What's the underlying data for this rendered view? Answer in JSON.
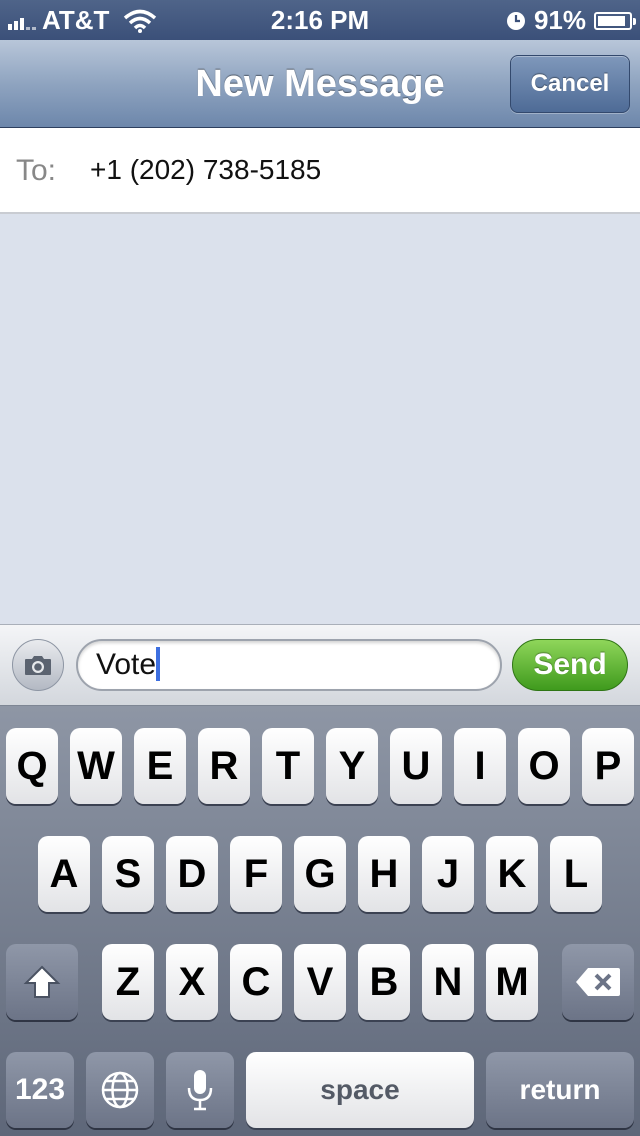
{
  "status_bar": {
    "carrier": "AT&T",
    "time": "2:16 PM",
    "battery_percent": "91%",
    "battery_level": 0.91,
    "icons": [
      "signal-icon",
      "wifi-icon",
      "clock-icon",
      "battery-icon"
    ]
  },
  "nav": {
    "title": "New Message",
    "cancel_label": "Cancel"
  },
  "to_field": {
    "label": "To:",
    "value": "+1 (202) 738-5185"
  },
  "compose": {
    "text": "Vote",
    "send_label": "Send",
    "camera_icon": "camera-icon"
  },
  "keyboard": {
    "row1": [
      "Q",
      "W",
      "E",
      "R",
      "T",
      "Y",
      "U",
      "I",
      "O",
      "P"
    ],
    "row2": [
      "A",
      "S",
      "D",
      "F",
      "G",
      "H",
      "J",
      "K",
      "L"
    ],
    "row3": [
      "Z",
      "X",
      "C",
      "V",
      "B",
      "N",
      "M"
    ],
    "numbers_label": "123",
    "space_label": "space",
    "return_label": "return",
    "shift_icon": "shift-icon",
    "delete_icon": "delete-icon",
    "globe_icon": "globe-icon",
    "mic_icon": "microphone-icon"
  },
  "colors": {
    "nav_bar": "#6d87ab",
    "send_green": "#3f9a1d",
    "caret": "#3d6fe0",
    "background": "#dbe1ec"
  }
}
